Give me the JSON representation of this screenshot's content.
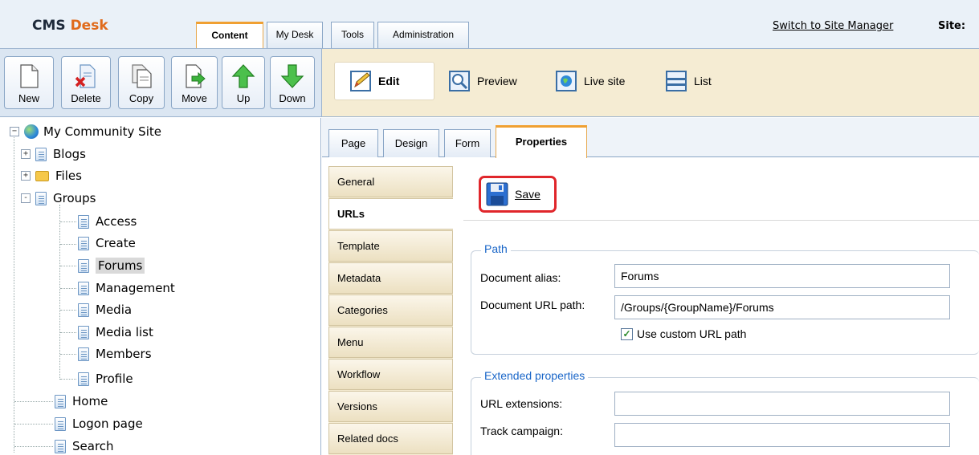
{
  "header": {
    "logo_cms": "CMS",
    "logo_desk": "Desk",
    "tabs": [
      {
        "label": "Content",
        "active": true
      },
      {
        "label": "My Desk",
        "active": false
      },
      {
        "label": "Tools",
        "active": false
      },
      {
        "label": "Administration",
        "active": false
      }
    ],
    "switch_link": "Switch to Site Manager",
    "site_label": "Site:"
  },
  "left_toolbar": {
    "buttons": [
      {
        "label": "New",
        "icon": "new-document-icon"
      },
      {
        "label": "Delete",
        "icon": "delete-document-icon"
      },
      {
        "label": "Copy",
        "icon": "copy-document-icon"
      },
      {
        "label": "Move",
        "icon": "move-document-icon"
      },
      {
        "label": "Up",
        "icon": "arrow-up-icon"
      },
      {
        "label": "Down",
        "icon": "arrow-down-icon"
      }
    ]
  },
  "view_modes": [
    {
      "label": "Edit",
      "icon": "edit-pencil-icon",
      "active": true
    },
    {
      "label": "Preview",
      "icon": "preview-magnifier-icon",
      "active": false
    },
    {
      "label": "Live site",
      "icon": "live-site-globe-icon",
      "active": false
    },
    {
      "label": "List",
      "icon": "list-icon",
      "active": false
    }
  ],
  "tree": {
    "root": "My Community Site",
    "items": [
      {
        "label": "Blogs",
        "expander": "+"
      },
      {
        "label": "Files",
        "expander": "+"
      },
      {
        "label": "Groups",
        "expander": "-"
      },
      {
        "label": "Access"
      },
      {
        "label": "Create"
      },
      {
        "label": "Forums",
        "selected": true
      },
      {
        "label": "Management"
      },
      {
        "label": "Media"
      },
      {
        "label": "Media list"
      },
      {
        "label": "Members"
      },
      {
        "label": "Profile"
      },
      {
        "label": "Home"
      },
      {
        "label": "Logon page"
      },
      {
        "label": "Search"
      }
    ]
  },
  "page_tabs": [
    {
      "label": "Page"
    },
    {
      "label": "Design"
    },
    {
      "label": "Form"
    },
    {
      "label": "Properties",
      "active": true
    }
  ],
  "property_tabs": [
    {
      "label": "General"
    },
    {
      "label": "URLs",
      "active": true
    },
    {
      "label": "Template"
    },
    {
      "label": "Metadata"
    },
    {
      "label": "Categories"
    },
    {
      "label": "Menu"
    },
    {
      "label": "Workflow"
    },
    {
      "label": "Versions"
    },
    {
      "label": "Related docs"
    }
  ],
  "save": {
    "label": "Save",
    "icon": "floppy-disk-icon"
  },
  "path_group": {
    "legend": "Path",
    "alias_label": "Document alias:",
    "alias_value": "Forums",
    "url_path_label": "Document URL path:",
    "url_path_value": "/Groups/{GroupName}/Forums",
    "custom_url_label": "Use custom URL path",
    "custom_url_checked": true
  },
  "extended_group": {
    "legend": "Extended properties",
    "url_extensions_label": "URL extensions:",
    "url_extensions_value": "",
    "track_campaign_label": "Track campaign:",
    "track_campaign_value": ""
  },
  "colors": {
    "accent_orange": "#f0a032",
    "save_highlight": "#e0262b",
    "legend_blue": "#1a66c8"
  }
}
